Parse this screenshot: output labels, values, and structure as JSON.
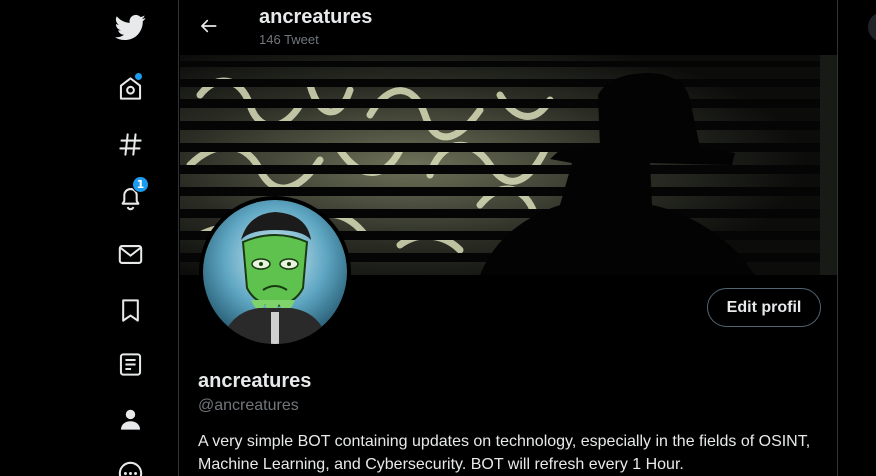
{
  "sidebar": {
    "items": [
      {
        "name": "logo"
      },
      {
        "name": "home",
        "has_dot": true
      },
      {
        "name": "explore"
      },
      {
        "name": "notifications",
        "badge": "1"
      },
      {
        "name": "messages"
      },
      {
        "name": "bookmarks"
      },
      {
        "name": "lists"
      },
      {
        "name": "profile"
      },
      {
        "name": "more"
      }
    ]
  },
  "header": {
    "title": "ancreatures",
    "tweet_count": "146 Tweet"
  },
  "profile": {
    "name": "ancreatures",
    "handle": "@ancreatures",
    "bio": "A very simple BOT containing updates on technology, especially in the fields of OSINT, Machine Learning, and Cybersecurity. BOT will refresh every 1 Hour.",
    "edit_label": "Edit profil"
  },
  "colors": {
    "accent": "#1d9bf0",
    "background": "#000000",
    "text_primary": "#e7e9ea",
    "text_secondary": "#71767b",
    "border": "#2f3336"
  }
}
